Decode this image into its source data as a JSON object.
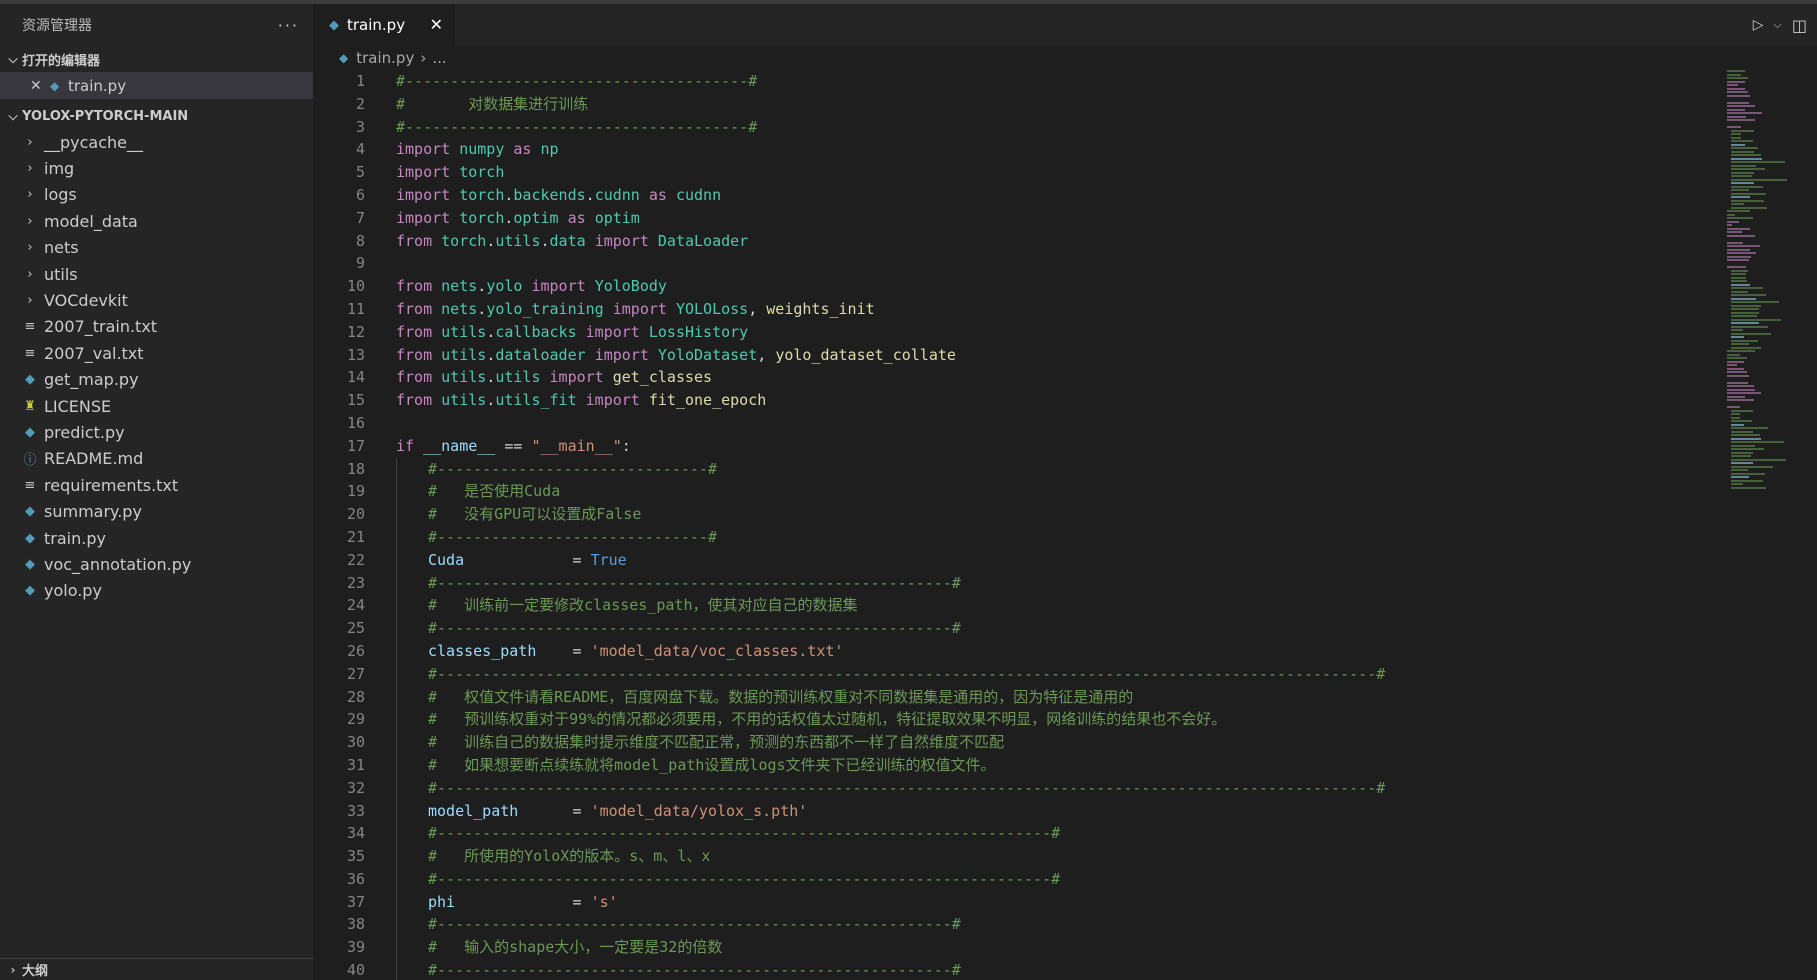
{
  "sidebar": {
    "title": "资源管理器",
    "more": "···",
    "open_editors": {
      "label": "打开的编辑器",
      "items": [
        {
          "name": "train.py"
        }
      ]
    },
    "project": {
      "label": "YOLOX-PYTORCH-MAIN",
      "entries": [
        {
          "name": "__pycache__",
          "kind": "folder"
        },
        {
          "name": "img",
          "kind": "folder"
        },
        {
          "name": "logs",
          "kind": "folder"
        },
        {
          "name": "model_data",
          "kind": "folder"
        },
        {
          "name": "nets",
          "kind": "folder"
        },
        {
          "name": "utils",
          "kind": "folder"
        },
        {
          "name": "VOCdevkit",
          "kind": "folder"
        },
        {
          "name": "2007_train.txt",
          "kind": "text"
        },
        {
          "name": "2007_val.txt",
          "kind": "text"
        },
        {
          "name": "get_map.py",
          "kind": "python"
        },
        {
          "name": "LICENSE",
          "kind": "license"
        },
        {
          "name": "predict.py",
          "kind": "python"
        },
        {
          "name": "README.md",
          "kind": "info"
        },
        {
          "name": "requirements.txt",
          "kind": "text"
        },
        {
          "name": "summary.py",
          "kind": "python"
        },
        {
          "name": "train.py",
          "kind": "python"
        },
        {
          "name": "voc_annotation.py",
          "kind": "python"
        },
        {
          "name": "yolo.py",
          "kind": "python"
        }
      ]
    },
    "outline_label": "大纲"
  },
  "editor": {
    "tab": {
      "label": "train.py"
    },
    "breadcrumb": {
      "file": "train.py",
      "rest": "..."
    },
    "lines": [
      {
        "n": "1",
        "indent": 0,
        "t": [
          [
            "c",
            "#--------------------------------------#"
          ]
        ]
      },
      {
        "n": "2",
        "indent": 0,
        "t": [
          [
            "c",
            "#       对数据集进行训练"
          ]
        ]
      },
      {
        "n": "3",
        "indent": 0,
        "t": [
          [
            "c",
            "#--------------------------------------#"
          ]
        ]
      },
      {
        "n": "4",
        "indent": 0,
        "t": [
          [
            "k",
            "import"
          ],
          [
            "p",
            " "
          ],
          [
            "m",
            "numpy"
          ],
          [
            "p",
            " "
          ],
          [
            "k",
            "as"
          ],
          [
            "p",
            " "
          ],
          [
            "m",
            "np"
          ]
        ]
      },
      {
        "n": "5",
        "indent": 0,
        "t": [
          [
            "k",
            "import"
          ],
          [
            "p",
            " "
          ],
          [
            "m",
            "torch"
          ]
        ]
      },
      {
        "n": "6",
        "indent": 0,
        "t": [
          [
            "k",
            "import"
          ],
          [
            "p",
            " "
          ],
          [
            "m",
            "torch"
          ],
          [
            "p",
            "."
          ],
          [
            "m",
            "backends"
          ],
          [
            "p",
            "."
          ],
          [
            "m",
            "cudnn"
          ],
          [
            "p",
            " "
          ],
          [
            "k",
            "as"
          ],
          [
            "p",
            " "
          ],
          [
            "m",
            "cudnn"
          ]
        ]
      },
      {
        "n": "7",
        "indent": 0,
        "t": [
          [
            "k",
            "import"
          ],
          [
            "p",
            " "
          ],
          [
            "m",
            "torch"
          ],
          [
            "p",
            "."
          ],
          [
            "m",
            "optim"
          ],
          [
            "p",
            " "
          ],
          [
            "k",
            "as"
          ],
          [
            "p",
            " "
          ],
          [
            "m",
            "optim"
          ]
        ]
      },
      {
        "n": "8",
        "indent": 0,
        "t": [
          [
            "k",
            "from"
          ],
          [
            "p",
            " "
          ],
          [
            "m",
            "torch"
          ],
          [
            "p",
            "."
          ],
          [
            "m",
            "utils"
          ],
          [
            "p",
            "."
          ],
          [
            "m",
            "data"
          ],
          [
            "p",
            " "
          ],
          [
            "k",
            "import"
          ],
          [
            "p",
            " "
          ],
          [
            "cl",
            "DataLoader"
          ]
        ]
      },
      {
        "n": "9",
        "indent": 0,
        "t": []
      },
      {
        "n": "10",
        "indent": 0,
        "t": [
          [
            "k",
            "from"
          ],
          [
            "p",
            " "
          ],
          [
            "m",
            "nets"
          ],
          [
            "p",
            "."
          ],
          [
            "m",
            "yolo"
          ],
          [
            "p",
            " "
          ],
          [
            "k",
            "import"
          ],
          [
            "p",
            " "
          ],
          [
            "cl",
            "YoloBody"
          ]
        ]
      },
      {
        "n": "11",
        "indent": 0,
        "t": [
          [
            "k",
            "from"
          ],
          [
            "p",
            " "
          ],
          [
            "m",
            "nets"
          ],
          [
            "p",
            "."
          ],
          [
            "m",
            "yolo_training"
          ],
          [
            "p",
            " "
          ],
          [
            "k",
            "import"
          ],
          [
            "p",
            " "
          ],
          [
            "cl",
            "YOLOLoss"
          ],
          [
            "p",
            ", "
          ],
          [
            "f",
            "weights_init"
          ]
        ]
      },
      {
        "n": "12",
        "indent": 0,
        "t": [
          [
            "k",
            "from"
          ],
          [
            "p",
            " "
          ],
          [
            "m",
            "utils"
          ],
          [
            "p",
            "."
          ],
          [
            "m",
            "callbacks"
          ],
          [
            "p",
            " "
          ],
          [
            "k",
            "import"
          ],
          [
            "p",
            " "
          ],
          [
            "cl",
            "LossHistory"
          ]
        ]
      },
      {
        "n": "13",
        "indent": 0,
        "t": [
          [
            "k",
            "from"
          ],
          [
            "p",
            " "
          ],
          [
            "m",
            "utils"
          ],
          [
            "p",
            "."
          ],
          [
            "m",
            "dataloader"
          ],
          [
            "p",
            " "
          ],
          [
            "k",
            "import"
          ],
          [
            "p",
            " "
          ],
          [
            "cl",
            "YoloDataset"
          ],
          [
            "p",
            ", "
          ],
          [
            "f",
            "yolo_dataset_collate"
          ]
        ]
      },
      {
        "n": "14",
        "indent": 0,
        "t": [
          [
            "k",
            "from"
          ],
          [
            "p",
            " "
          ],
          [
            "m",
            "utils"
          ],
          [
            "p",
            "."
          ],
          [
            "m",
            "utils"
          ],
          [
            "p",
            " "
          ],
          [
            "k",
            "import"
          ],
          [
            "p",
            " "
          ],
          [
            "f",
            "get_classes"
          ]
        ]
      },
      {
        "n": "15",
        "indent": 0,
        "t": [
          [
            "k",
            "from"
          ],
          [
            "p",
            " "
          ],
          [
            "m",
            "utils"
          ],
          [
            "p",
            "."
          ],
          [
            "m",
            "utils_fit"
          ],
          [
            "p",
            " "
          ],
          [
            "k",
            "import"
          ],
          [
            "p",
            " "
          ],
          [
            "f",
            "fit_one_epoch"
          ]
        ]
      },
      {
        "n": "16",
        "indent": 0,
        "t": []
      },
      {
        "n": "17",
        "indent": 0,
        "t": [
          [
            "k",
            "if"
          ],
          [
            "p",
            " "
          ],
          [
            "v",
            "__name__"
          ],
          [
            "p",
            " == "
          ],
          [
            "s",
            "\"__main__\""
          ],
          [
            "p",
            ":"
          ]
        ]
      },
      {
        "n": "18",
        "indent": 1,
        "t": [
          [
            "c",
            "#------------------------------#"
          ]
        ]
      },
      {
        "n": "19",
        "indent": 1,
        "t": [
          [
            "c",
            "#   是否使用Cuda"
          ]
        ]
      },
      {
        "n": "20",
        "indent": 1,
        "t": [
          [
            "c",
            "#   没有GPU可以设置成False"
          ]
        ]
      },
      {
        "n": "21",
        "indent": 1,
        "t": [
          [
            "c",
            "#------------------------------#"
          ]
        ]
      },
      {
        "n": "22",
        "indent": 1,
        "t": [
          [
            "v",
            "Cuda"
          ],
          [
            "p",
            "            = "
          ],
          [
            "b",
            "True"
          ]
        ]
      },
      {
        "n": "23",
        "indent": 1,
        "t": [
          [
            "c",
            "#---------------------------------------------------------#"
          ]
        ]
      },
      {
        "n": "24",
        "indent": 1,
        "t": [
          [
            "c",
            "#   训练前一定要修改classes_path，使其对应自己的数据集"
          ]
        ]
      },
      {
        "n": "25",
        "indent": 1,
        "t": [
          [
            "c",
            "#---------------------------------------------------------#"
          ]
        ]
      },
      {
        "n": "26",
        "indent": 1,
        "t": [
          [
            "v",
            "classes_path"
          ],
          [
            "p",
            "    = "
          ],
          [
            "s",
            "'model_data/voc_classes.txt'"
          ]
        ]
      },
      {
        "n": "27",
        "indent": 1,
        "t": [
          [
            "c",
            "#--------------------------------------------------------------------------------------------------------#"
          ]
        ]
      },
      {
        "n": "28",
        "indent": 1,
        "t": [
          [
            "c",
            "#   权值文件请看README，百度网盘下载。数据的预训练权重对不同数据集是通用的，因为特征是通用的"
          ]
        ]
      },
      {
        "n": "29",
        "indent": 1,
        "t": [
          [
            "c",
            "#   预训练权重对于99%的情况都必须要用，不用的话权值太过随机，特征提取效果不明显，网络训练的结果也不会好。"
          ]
        ]
      },
      {
        "n": "30",
        "indent": 1,
        "t": [
          [
            "c",
            "#   训练自己的数据集时提示维度不匹配正常，预测的东西都不一样了自然维度不匹配"
          ]
        ]
      },
      {
        "n": "31",
        "indent": 1,
        "t": [
          [
            "c",
            "#   如果想要断点续练就将model_path设置成logs文件夹下已经训练的权值文件。"
          ]
        ]
      },
      {
        "n": "32",
        "indent": 1,
        "t": [
          [
            "c",
            "#--------------------------------------------------------------------------------------------------------#"
          ]
        ]
      },
      {
        "n": "33",
        "indent": 1,
        "t": [
          [
            "v",
            "model_path"
          ],
          [
            "p",
            "      = "
          ],
          [
            "s",
            "'model_data/yolox_s.pth'"
          ]
        ]
      },
      {
        "n": "34",
        "indent": 1,
        "t": [
          [
            "c",
            "#--------------------------------------------------------------------#"
          ]
        ]
      },
      {
        "n": "35",
        "indent": 1,
        "t": [
          [
            "c",
            "#   所使用的YoloX的版本。s、m、l、x"
          ]
        ]
      },
      {
        "n": "36",
        "indent": 1,
        "t": [
          [
            "c",
            "#--------------------------------------------------------------------#"
          ]
        ]
      },
      {
        "n": "37",
        "indent": 1,
        "t": [
          [
            "v",
            "phi"
          ],
          [
            "p",
            "             = "
          ],
          [
            "s",
            "'s'"
          ]
        ]
      },
      {
        "n": "38",
        "indent": 1,
        "t": [
          [
            "c",
            "#---------------------------------------------------------#"
          ]
        ]
      },
      {
        "n": "39",
        "indent": 1,
        "t": [
          [
            "c",
            "#   输入的shape大小，一定要是32的倍数"
          ]
        ]
      },
      {
        "n": "40",
        "indent": 1,
        "t": [
          [
            "c",
            "#---------------------------------------------------------#"
          ]
        ]
      }
    ]
  },
  "colors": {
    "comment": "#6a9955",
    "keyword": "#c586c0",
    "module": "#4ec9b0",
    "function": "#dcdcaa",
    "variable": "#9cdcfe",
    "string": "#ce9178",
    "constant": "#569cd6",
    "python_icon": "#519aba"
  },
  "icons": {
    "run": "play-icon",
    "split": "split-editor-icon",
    "close": "close-icon",
    "python": "python-file-icon",
    "text": "text-file-icon",
    "license": "license-icon",
    "info": "info-icon",
    "chevron": "chevron-icon"
  }
}
